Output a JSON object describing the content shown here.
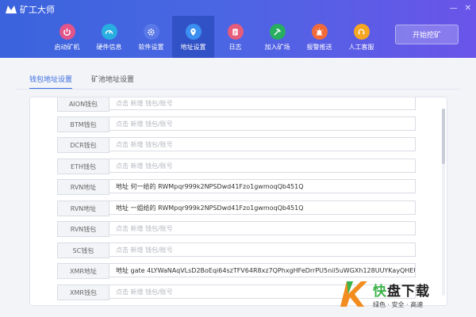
{
  "app": {
    "title": "矿工大师"
  },
  "nav": [
    {
      "label": "启动矿机",
      "icon": "power-icon",
      "color": "#e2558b"
    },
    {
      "label": "硬件信息",
      "icon": "gauge-icon",
      "color": "#28aee0"
    },
    {
      "label": "软件设置",
      "icon": "gear-icon",
      "color": "#5a78e8"
    },
    {
      "label": "地址设置",
      "icon": "location-icon",
      "color": "#3a8ff0"
    },
    {
      "label": "日志",
      "icon": "document-icon",
      "color": "#e65c7a"
    },
    {
      "label": "加入矿场",
      "icon": "pickaxe-icon",
      "color": "#27ae60"
    },
    {
      "label": "报警推送",
      "icon": "alarm-icon",
      "color": "#f06a3a"
    },
    {
      "label": "人工客服",
      "icon": "support-icon",
      "color": "#f5a623"
    }
  ],
  "start_button": "开始挖矿",
  "tabs": [
    {
      "label": "钱包地址设置",
      "active": true
    },
    {
      "label": "矿池地址设置",
      "active": false
    }
  ],
  "rows": [
    {
      "label": "AION钱包",
      "value": "点击 新增 钱包/账号",
      "placeholder": true
    },
    {
      "label": "BTM钱包",
      "value": "点击 新增 钱包/账号",
      "placeholder": true
    },
    {
      "label": "DCR钱包",
      "value": "点击 新增 钱包/账号",
      "placeholder": true
    },
    {
      "label": "ETH钱包",
      "value": "点击 新增 钱包/账号",
      "placeholder": true
    },
    {
      "label": "RVN地址",
      "value": "地址 何一给的 RWMpqr999k2NPSDwd41Fzo1gwmoqQb451Q",
      "placeholder": false
    },
    {
      "label": "RVN地址",
      "value": "地址 一姐给的 RWMpqr999k2NPSDwd41Fzo1gwmoqQb451Q",
      "placeholder": false
    },
    {
      "label": "RVN钱包",
      "value": "点击 新增 钱包/账号",
      "placeholder": true
    },
    {
      "label": "SC钱包",
      "value": "点击 新增 钱包/账号",
      "placeholder": true
    },
    {
      "label": "XMR地址",
      "value": "地址 gate 4LYWaNAqVLsD2BoEqi64szTFV64R8xz7QPhxgHFeDrrPU5nii5uWGXh128UUYKayQHEU",
      "placeholder": false
    },
    {
      "label": "XMR钱包",
      "value": "点击 新增 钱包/账号",
      "placeholder": true
    }
  ],
  "watermark": {
    "brand_green": "快",
    "brand_rest": "盘下载",
    "slogan": "绿色 · 安全 · 高速"
  },
  "window_controls": [
    "—",
    "✕"
  ]
}
